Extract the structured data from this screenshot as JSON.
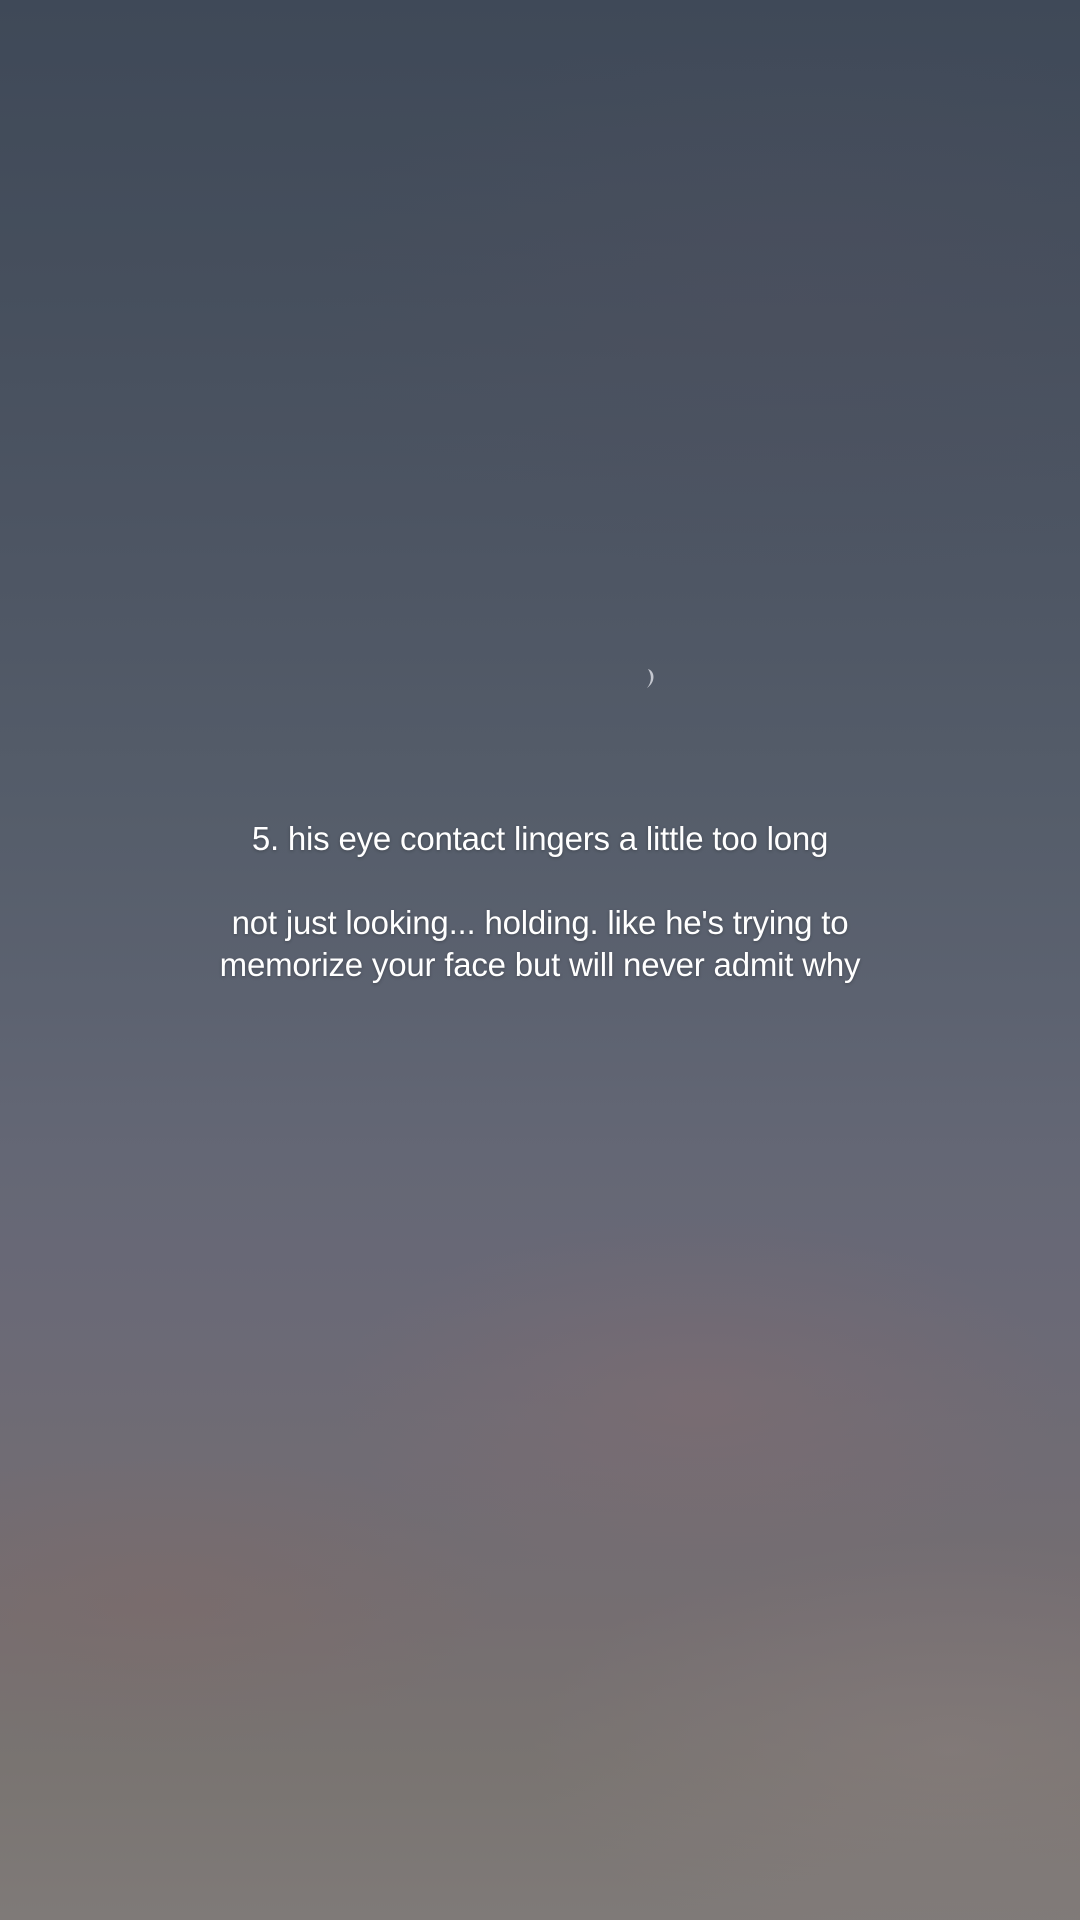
{
  "background": {
    "description_colors": {
      "top": "#3f4958",
      "middle": "#5c6270",
      "bottom": "#7f7a78",
      "text": "#ffffff"
    },
    "icon": "crescent-moon-icon"
  },
  "caption": {
    "heading": "5. his eye contact lingers a little too long",
    "body": "not just looking... holding. like he's trying to memorize your face but will never admit why"
  }
}
